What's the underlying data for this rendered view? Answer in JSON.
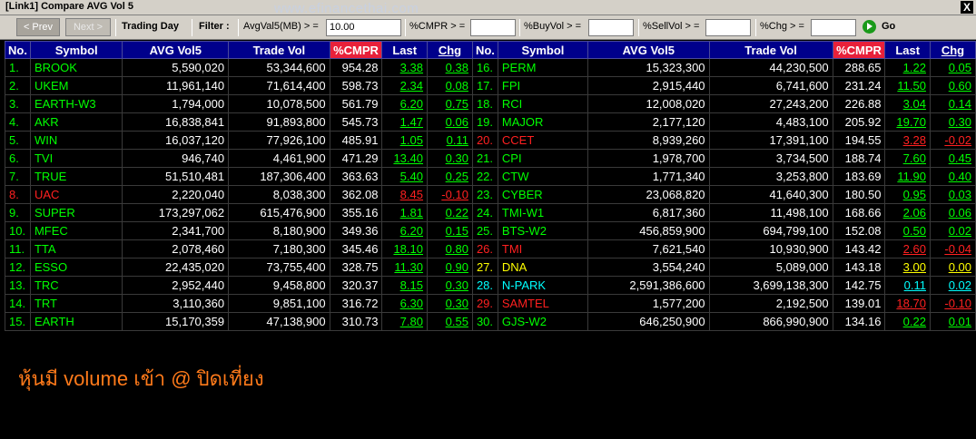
{
  "window": {
    "title": "[Link1] Compare AVG Vol 5",
    "watermark": "www.efinancethai.com",
    "close_label": "X"
  },
  "toolbar": {
    "prev_label": "< Prev",
    "next_label": "Next >",
    "trading_day_label": "Trading Day",
    "filter_label": "Filter :",
    "filters": [
      {
        "label": "AvgVal5(MB) > =",
        "value": "10.00"
      },
      {
        "label": "%CMPR > =",
        "value": ""
      },
      {
        "label": "%BuyVol > =",
        "value": ""
      },
      {
        "label": "%SellVol > =",
        "value": ""
      },
      {
        "label": "%Chg > =",
        "value": ""
      }
    ],
    "go_label": "Go"
  },
  "colors": {
    "up": "#00ff00",
    "down": "#ff2020",
    "unchanged": "#ffff00",
    "ceiling": "#00ffff",
    "header_bg": "#00008b",
    "cmpr_header_bg": "#e8203a",
    "note": "#ff7a1a"
  },
  "columns": [
    "No.",
    "Symbol",
    "AVG Vol5",
    "Trade Vol",
    "%CMPR",
    "Last",
    "Chg"
  ],
  "rows": [
    {
      "no": "1.",
      "symbol": "BROOK",
      "avg_vol5": "5,590,020",
      "trade_vol": "53,344,600",
      "cmpr": "954.28",
      "last": "3.38",
      "chg": "0.38",
      "status": "up"
    },
    {
      "no": "2.",
      "symbol": "UKEM",
      "avg_vol5": "11,961,140",
      "trade_vol": "71,614,400",
      "cmpr": "598.73",
      "last": "2.34",
      "chg": "0.08",
      "status": "up"
    },
    {
      "no": "3.",
      "symbol": "EARTH-W3",
      "avg_vol5": "1,794,000",
      "trade_vol": "10,078,500",
      "cmpr": "561.79",
      "last": "6.20",
      "chg": "0.75",
      "status": "up"
    },
    {
      "no": "4.",
      "symbol": "AKR",
      "avg_vol5": "16,838,841",
      "trade_vol": "91,893,800",
      "cmpr": "545.73",
      "last": "1.47",
      "chg": "0.06",
      "status": "up"
    },
    {
      "no": "5.",
      "symbol": "WIN",
      "avg_vol5": "16,037,120",
      "trade_vol": "77,926,100",
      "cmpr": "485.91",
      "last": "1.05",
      "chg": "0.11",
      "status": "up"
    },
    {
      "no": "6.",
      "symbol": "TVI",
      "avg_vol5": "946,740",
      "trade_vol": "4,461,900",
      "cmpr": "471.29",
      "last": "13.40",
      "chg": "0.30",
      "status": "up"
    },
    {
      "no": "7.",
      "symbol": "TRUE",
      "avg_vol5": "51,510,481",
      "trade_vol": "187,306,400",
      "cmpr": "363.63",
      "last": "5.40",
      "chg": "0.25",
      "status": "up"
    },
    {
      "no": "8.",
      "symbol": "UAC",
      "avg_vol5": "2,220,040",
      "trade_vol": "8,038,300",
      "cmpr": "362.08",
      "last": "8.45",
      "chg": "-0.10",
      "status": "down"
    },
    {
      "no": "9.",
      "symbol": "SUPER",
      "avg_vol5": "173,297,062",
      "trade_vol": "615,476,900",
      "cmpr": "355.16",
      "last": "1.81",
      "chg": "0.22",
      "status": "up"
    },
    {
      "no": "10.",
      "symbol": "MFEC",
      "avg_vol5": "2,341,700",
      "trade_vol": "8,180,900",
      "cmpr": "349.36",
      "last": "6.20",
      "chg": "0.15",
      "status": "up"
    },
    {
      "no": "11.",
      "symbol": "TTA",
      "avg_vol5": "2,078,460",
      "trade_vol": "7,180,300",
      "cmpr": "345.46",
      "last": "18.10",
      "chg": "0.80",
      "status": "up"
    },
    {
      "no": "12.",
      "symbol": "ESSO",
      "avg_vol5": "22,435,020",
      "trade_vol": "73,755,400",
      "cmpr": "328.75",
      "last": "11.30",
      "chg": "0.90",
      "status": "up"
    },
    {
      "no": "13.",
      "symbol": "TRC",
      "avg_vol5": "2,952,440",
      "trade_vol": "9,458,800",
      "cmpr": "320.37",
      "last": "8.15",
      "chg": "0.30",
      "status": "up"
    },
    {
      "no": "14.",
      "symbol": "TRT",
      "avg_vol5": "3,110,360",
      "trade_vol": "9,851,100",
      "cmpr": "316.72",
      "last": "6.30",
      "chg": "0.30",
      "status": "up"
    },
    {
      "no": "15.",
      "symbol": "EARTH",
      "avg_vol5": "15,170,359",
      "trade_vol": "47,138,900",
      "cmpr": "310.73",
      "last": "7.80",
      "chg": "0.55",
      "status": "up"
    },
    {
      "no": "16.",
      "symbol": "PERM",
      "avg_vol5": "15,323,300",
      "trade_vol": "44,230,500",
      "cmpr": "288.65",
      "last": "1.22",
      "chg": "0.05",
      "status": "up"
    },
    {
      "no": "17.",
      "symbol": "FPI",
      "avg_vol5": "2,915,440",
      "trade_vol": "6,741,600",
      "cmpr": "231.24",
      "last": "11.50",
      "chg": "0.60",
      "status": "up"
    },
    {
      "no": "18.",
      "symbol": "RCI",
      "avg_vol5": "12,008,020",
      "trade_vol": "27,243,200",
      "cmpr": "226.88",
      "last": "3.04",
      "chg": "0.14",
      "status": "up"
    },
    {
      "no": "19.",
      "symbol": "MAJOR",
      "avg_vol5": "2,177,120",
      "trade_vol": "4,483,100",
      "cmpr": "205.92",
      "last": "19.70",
      "chg": "0.30",
      "status": "up"
    },
    {
      "no": "20.",
      "symbol": "CCET",
      "avg_vol5": "8,939,260",
      "trade_vol": "17,391,100",
      "cmpr": "194.55",
      "last": "3.28",
      "chg": "-0.02",
      "status": "down"
    },
    {
      "no": "21.",
      "symbol": "CPI",
      "avg_vol5": "1,978,700",
      "trade_vol": "3,734,500",
      "cmpr": "188.74",
      "last": "7.60",
      "chg": "0.45",
      "status": "up"
    },
    {
      "no": "22.",
      "symbol": "CTW",
      "avg_vol5": "1,771,340",
      "trade_vol": "3,253,800",
      "cmpr": "183.69",
      "last": "11.90",
      "chg": "0.40",
      "status": "up"
    },
    {
      "no": "23.",
      "symbol": "CYBER",
      "avg_vol5": "23,068,820",
      "trade_vol": "41,640,300",
      "cmpr": "180.50",
      "last": "0.95",
      "chg": "0.03",
      "status": "up"
    },
    {
      "no": "24.",
      "symbol": "TMI-W1",
      "avg_vol5": "6,817,360",
      "trade_vol": "11,498,100",
      "cmpr": "168.66",
      "last": "2.06",
      "chg": "0.06",
      "status": "up"
    },
    {
      "no": "25.",
      "symbol": "BTS-W2",
      "avg_vol5": "456,859,900",
      "trade_vol": "694,799,100",
      "cmpr": "152.08",
      "last": "0.50",
      "chg": "0.02",
      "status": "up"
    },
    {
      "no": "26.",
      "symbol": "TMI",
      "avg_vol5": "7,621,540",
      "trade_vol": "10,930,900",
      "cmpr": "143.42",
      "last": "2.60",
      "chg": "-0.04",
      "status": "down"
    },
    {
      "no": "27.",
      "symbol": "DNA",
      "avg_vol5": "3,554,240",
      "trade_vol": "5,089,000",
      "cmpr": "143.18",
      "last": "3.00",
      "chg": "0.00",
      "status": "unchanged"
    },
    {
      "no": "28.",
      "symbol": "N-PARK",
      "avg_vol5": "2,591,386,600",
      "trade_vol": "3,699,138,300",
      "cmpr": "142.75",
      "last": "0.11",
      "chg": "0.02",
      "status": "ceiling"
    },
    {
      "no": "29.",
      "symbol": "SAMTEL",
      "avg_vol5": "1,577,200",
      "trade_vol": "2,192,500",
      "cmpr": "139.01",
      "last": "18.70",
      "chg": "-0.10",
      "status": "down"
    },
    {
      "no": "30.",
      "symbol": "GJS-W2",
      "avg_vol5": "646,250,900",
      "trade_vol": "866,990,900",
      "cmpr": "134.16",
      "last": "0.22",
      "chg": "0.01",
      "status": "up"
    }
  ],
  "note": "หุ้นมี volume เข้า @ ปิดเที่ยง"
}
